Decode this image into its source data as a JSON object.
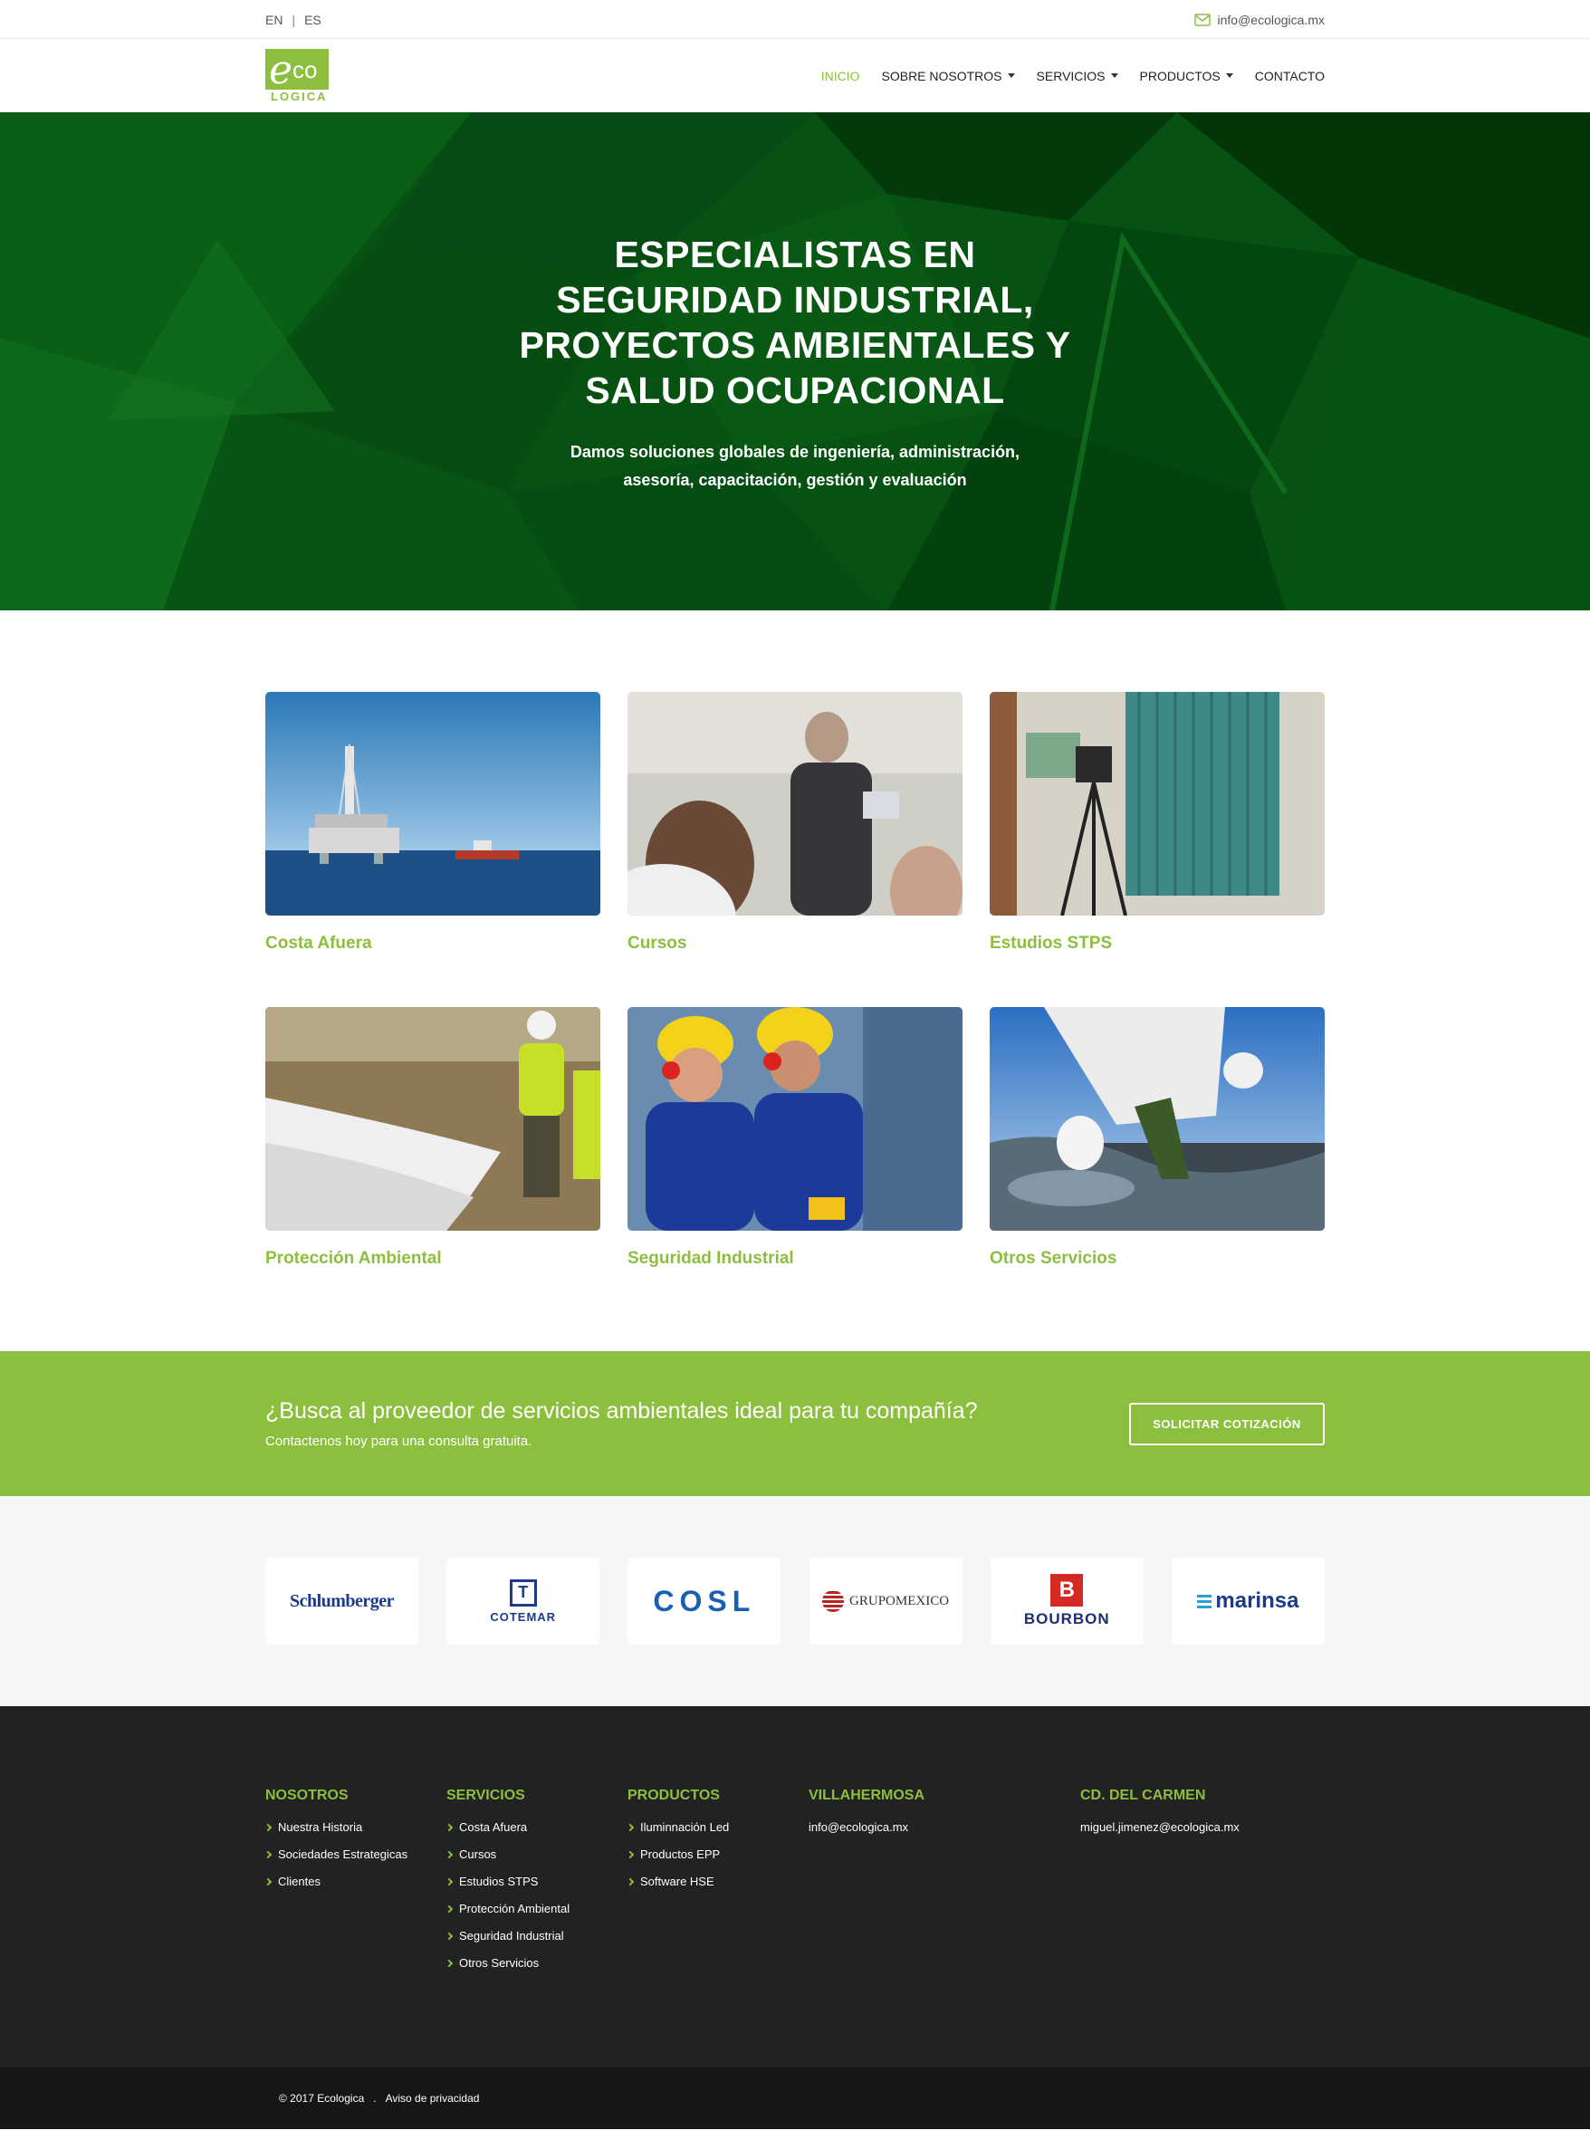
{
  "topbar": {
    "lang_en": "EN",
    "lang_sep": "|",
    "lang_es": "ES",
    "email": "info@ecologica.mx"
  },
  "logo": {
    "e": "e",
    "co": "co",
    "word": "LOGICA"
  },
  "nav": {
    "items": [
      {
        "label": "INICIO",
        "active": true
      },
      {
        "label": "SOBRE NOSOTROS",
        "dropdown": true
      },
      {
        "label": "SERVICIOS",
        "dropdown": true
      },
      {
        "label": "PRODUCTOS",
        "dropdown": true
      },
      {
        "label": "CONTACTO"
      }
    ]
  },
  "hero": {
    "title": "ESPECIALISTAS EN SEGURIDAD INDUSTRIAL, PROYECTOS AMBIENTALES Y SALUD OCUPACIONAL",
    "subtitle": "Damos soluciones globales de ingeniería, administración, asesoría, capacitación, gestión y evaluación"
  },
  "services": [
    {
      "label": "Costa Afuera"
    },
    {
      "label": "Cursos"
    },
    {
      "label": "Estudios STPS"
    },
    {
      "label": "Protección Ambiental"
    },
    {
      "label": "Seguridad Industrial"
    },
    {
      "label": "Otros Servicios"
    }
  ],
  "cta": {
    "title": "¿Busca al proveedor de servicios ambientales ideal para tu compañía?",
    "subtitle": "Contactenos hoy para una consulta gratuita.",
    "button": "SOLICITAR COTIZACIÓN"
  },
  "clients": {
    "schlumberger": "Schlumberger",
    "cotemar": "COTEMAR",
    "cosl": "COSL",
    "grupomexico": "GRUPOMEXICO",
    "bourbon": "BOURBON",
    "marinsa": "marinsa"
  },
  "footer": {
    "nosotros": {
      "title": "NOSOTROS",
      "items": [
        "Nuestra Historia",
        "Sociedades Estrategicas",
        "Clientes"
      ]
    },
    "servicios": {
      "title": "SERVICIOS",
      "items": [
        "Costa Afuera",
        "Cursos",
        "Estudios STPS",
        "Protección Ambiental",
        "Seguridad Industrial",
        "Otros Servicios"
      ]
    },
    "productos": {
      "title": "PRODUCTOS",
      "items": [
        "Iluminnación Led",
        "Productos EPP",
        "Software HSE"
      ]
    },
    "villahermosa": {
      "title": "VILLAHERMOSA",
      "email": "info@ecologica.mx"
    },
    "carmen": {
      "title": "CD. DEL CARMEN",
      "email": "miguel.jimenez@ecologica.mx"
    }
  },
  "copyright": {
    "text": "© 2017 Ecologica",
    "dot": ".",
    "privacy": "Aviso de privacidad"
  },
  "colors": {
    "accent": "#8dbf3f",
    "hero": "#064a12",
    "footer": "#222222"
  }
}
